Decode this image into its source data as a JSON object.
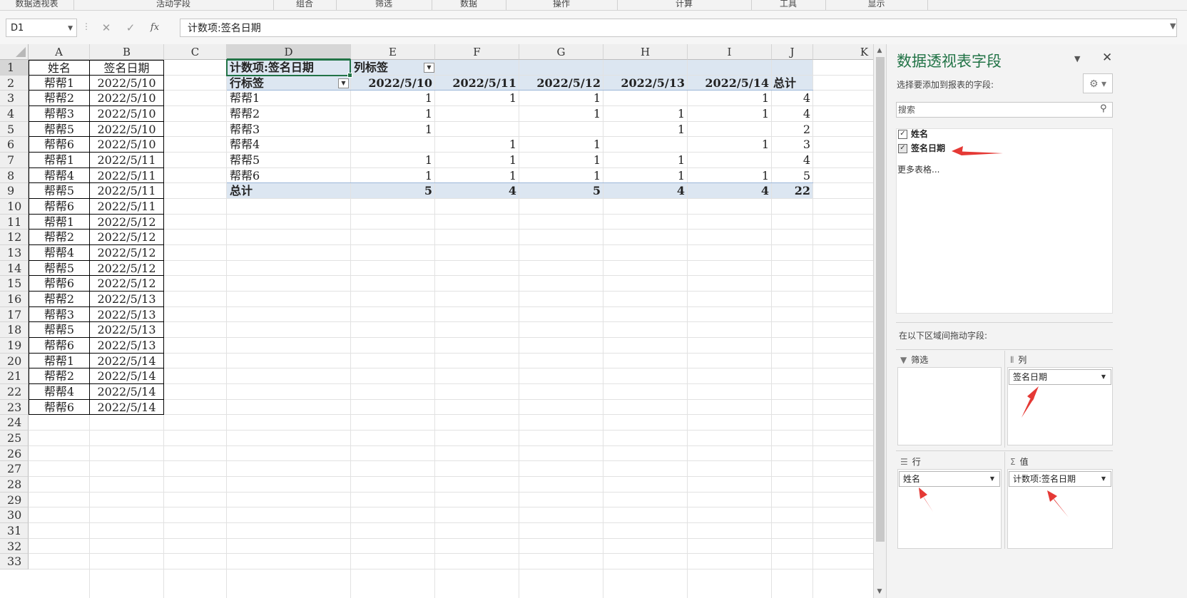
{
  "ribbon": {
    "groups": [
      "数据透视表",
      "活动字段",
      "组合",
      "筛选",
      "数据",
      "操作",
      "计算",
      "工具",
      "显示"
    ]
  },
  "formula_bar": {
    "name_box": "D1",
    "cancel_icon": "close-icon",
    "enter_icon": "check-icon",
    "function_label": "fx",
    "formula": "计数项:签名日期"
  },
  "sheet": {
    "columns": [
      "A",
      "B",
      "C",
      "D",
      "E",
      "F",
      "G",
      "H",
      "I",
      "J",
      "K"
    ],
    "rows": [
      "1",
      "2",
      "3",
      "4",
      "5",
      "6",
      "7",
      "8",
      "9",
      "10",
      "11",
      "12",
      "13",
      "14",
      "15",
      "16",
      "17",
      "18",
      "19",
      "20",
      "21",
      "22",
      "23",
      "24",
      "25",
      "26",
      "27",
      "28",
      "29",
      "30",
      "31",
      "32",
      "33"
    ],
    "source_headers": [
      "姓名",
      "签名日期"
    ],
    "source_rows": [
      [
        "帮帮1",
        "2022/5/10"
      ],
      [
        "帮帮2",
        "2022/5/10"
      ],
      [
        "帮帮3",
        "2022/5/10"
      ],
      [
        "帮帮5",
        "2022/5/10"
      ],
      [
        "帮帮6",
        "2022/5/10"
      ],
      [
        "帮帮1",
        "2022/5/11"
      ],
      [
        "帮帮4",
        "2022/5/11"
      ],
      [
        "帮帮5",
        "2022/5/11"
      ],
      [
        "帮帮6",
        "2022/5/11"
      ],
      [
        "帮帮1",
        "2022/5/12"
      ],
      [
        "帮帮2",
        "2022/5/12"
      ],
      [
        "帮帮4",
        "2022/5/12"
      ],
      [
        "帮帮5",
        "2022/5/12"
      ],
      [
        "帮帮6",
        "2022/5/12"
      ],
      [
        "帮帮2",
        "2022/5/13"
      ],
      [
        "帮帮3",
        "2022/5/13"
      ],
      [
        "帮帮5",
        "2022/5/13"
      ],
      [
        "帮帮6",
        "2022/5/13"
      ],
      [
        "帮帮1",
        "2022/5/14"
      ],
      [
        "帮帮2",
        "2022/5/14"
      ],
      [
        "帮帮4",
        "2022/5/14"
      ],
      [
        "帮帮6",
        "2022/5/14"
      ]
    ],
    "pivot": {
      "value_field": "计数项:签名日期",
      "column_labels": "列标签",
      "row_labels": "行标签",
      "dates": [
        "2022/5/10",
        "2022/5/11",
        "2022/5/12",
        "2022/5/13",
        "2022/5/14"
      ],
      "grand_total_label": "总计",
      "rows": [
        {
          "name": "帮帮1",
          "values": [
            "1",
            "1",
            "1",
            "",
            "1"
          ],
          "total": "4"
        },
        {
          "name": "帮帮2",
          "values": [
            "1",
            "",
            "1",
            "1",
            "1"
          ],
          "total": "4"
        },
        {
          "name": "帮帮3",
          "values": [
            "1",
            "",
            "",
            "1",
            ""
          ],
          "total": "2"
        },
        {
          "name": "帮帮4",
          "values": [
            "",
            "1",
            "1",
            "",
            "1"
          ],
          "total": "3"
        },
        {
          "name": "帮帮5",
          "values": [
            "1",
            "1",
            "1",
            "1",
            ""
          ],
          "total": "4"
        },
        {
          "name": "帮帮6",
          "values": [
            "1",
            "1",
            "1",
            "1",
            "1"
          ],
          "total": "5"
        }
      ],
      "column_totals": [
        "5",
        "4",
        "5",
        "4",
        "4"
      ],
      "grand_total": "22"
    }
  },
  "pane": {
    "title": "数据透视表字段",
    "subtitle": "选择要添加到报表的字段:",
    "search_placeholder": "搜索",
    "fields": [
      {
        "label": "姓名",
        "checked": true
      },
      {
        "label": "签名日期",
        "checked": true
      }
    ],
    "more_tables": "更多表格...",
    "drag_hint": "在以下区域间拖动字段:",
    "areas": {
      "filter": {
        "label": "筛选",
        "icon": "filter-icon",
        "items": []
      },
      "columns": {
        "label": "列",
        "icon": "columns-icon",
        "items": [
          "签名日期"
        ]
      },
      "rows": {
        "label": "行",
        "icon": "rows-icon",
        "items": [
          "姓名"
        ]
      },
      "values": {
        "label": "值",
        "icon": "sigma-icon",
        "items": [
          "计数项:签名日期"
        ]
      }
    }
  },
  "colors": {
    "accent_green": "#217346",
    "pivot_band": "#dce6f1",
    "annotation_arrow": "#e53935"
  }
}
